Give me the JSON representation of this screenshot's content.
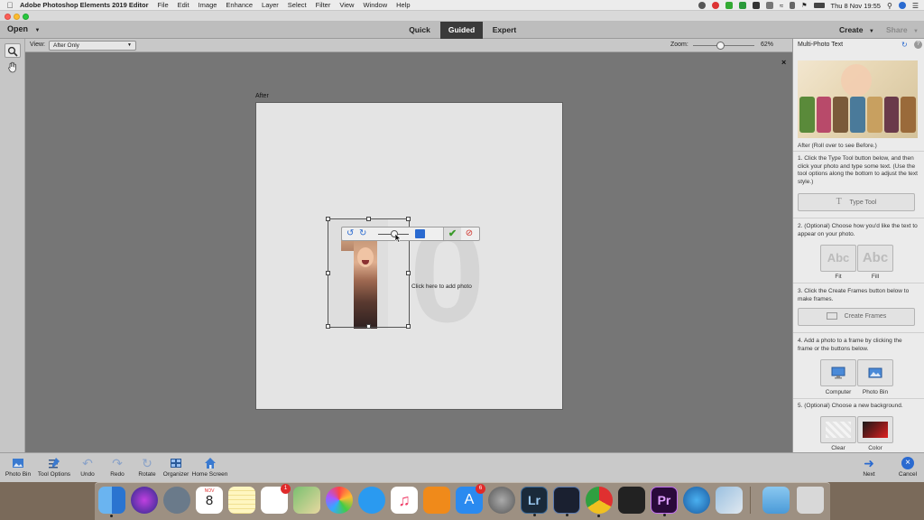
{
  "menubar": {
    "app_name": "Adobe Photoshop Elements 2019 Editor",
    "menus": [
      "File",
      "Edit",
      "Image",
      "Enhance",
      "Layer",
      "Select",
      "Filter",
      "View",
      "Window",
      "Help"
    ],
    "clock": "Thu 8 Nov 19:55"
  },
  "toolbar": {
    "open_label": "Open",
    "modes": [
      "Quick",
      "Guided",
      "Expert"
    ],
    "active_mode": "Guided",
    "create_label": "Create",
    "share_label": "Share"
  },
  "options": {
    "view_label": "View:",
    "view_value": "After Only",
    "zoom_label": "Zoom:",
    "zoom_value": "62%",
    "zoom_fraction": 0.62
  },
  "canvas": {
    "after_label": "After",
    "frame_hint": "Click here to add photo",
    "big_glyphs": "10"
  },
  "panel": {
    "title": "Multi-Photo Text",
    "preview_caption": "After (Roll over to see Before.)",
    "step1": "1. Click the Type Tool button below, and then click your photo and type some text. (Use the tool options along the bottom to adjust the text style.)",
    "type_tool_label": "Type Tool",
    "step2": "2. (Optional) Choose how you'd like the text to appear on your photo.",
    "fit_label": "Fit",
    "fill_label": "Fill",
    "abc_text": "Abc",
    "step3": "3. Click the Create Frames button below to make frames.",
    "create_frames_label": "Create Frames",
    "step4": "4. Add a photo to a frame by clicking the frame or the buttons below.",
    "computer_label": "Computer",
    "photo_bin_label": "Photo Bin",
    "step5": "5. (Optional) Choose a new background.",
    "clear_label": "Clear",
    "color_label": "Color"
  },
  "bottombar": {
    "items": [
      "Photo Bin",
      "Tool Options",
      "Undo",
      "Redo",
      "Rotate",
      "Organizer",
      "Home Screen"
    ],
    "next_label": "Next",
    "cancel_label": "Cancel"
  },
  "dock": {
    "calendar_month": "NOV",
    "calendar_day": "8",
    "reminders_badge": "1",
    "appstore_badge": "6",
    "lr_label": "Lr",
    "pr_label": "Pr"
  },
  "colors": {
    "active_tab": "#3a3a3a",
    "accent_blue": "#2a7de1",
    "commit_green": "#3a9a2a",
    "cancel_red": "#d0342c"
  }
}
